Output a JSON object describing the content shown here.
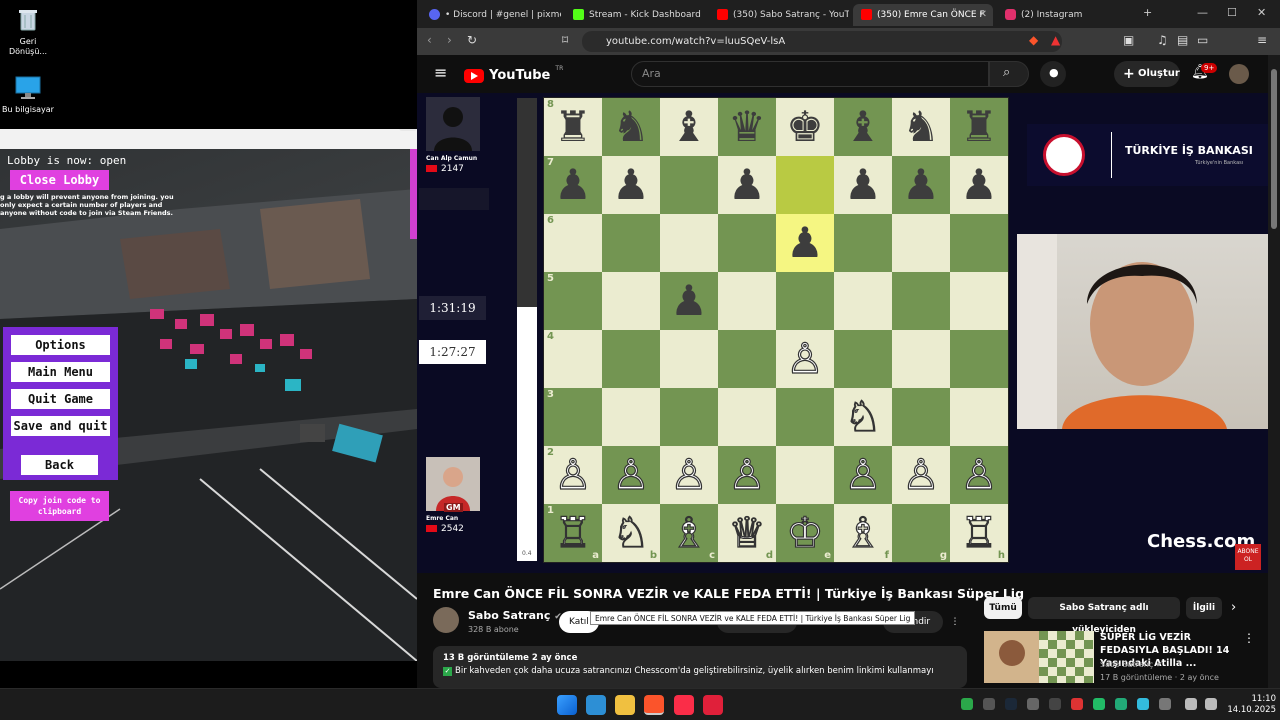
{
  "desktop": {
    "icons": [
      {
        "label": "Geri Dönüşü...",
        "icon": "recycle-bin-icon"
      },
      {
        "label": "Bu bilgisayar",
        "icon": "this-pc-icon"
      }
    ]
  },
  "game": {
    "lobby_status": "Lobby is now: open",
    "close_lobby": "Close Lobby",
    "lobby_note": "g a lobby will prevent anyone from joining. you only expect a certain number of players and anyone without code to join via Steam Friends.",
    "menu": {
      "options": "Options",
      "main_menu": "Main Menu",
      "quit_game": "Quit Game",
      "save_and_quit": "Save and quit",
      "back": "Back"
    },
    "copy_join_code": "Copy join code to clipboard",
    "accent_color": "#e040e0",
    "panel_color": "#7b2ad6"
  },
  "browser": {
    "tabs": [
      {
        "label": "• Discord | #genel | pixmens",
        "icon": "discord-icon",
        "color": "#5865f2"
      },
      {
        "label": "Stream - Kick Dashboard",
        "icon": "kick-icon",
        "color": "#53fc18"
      },
      {
        "label": "(350) Sabo Satranç - YouTube",
        "icon": "youtube-icon",
        "color": "#ff0000"
      },
      {
        "label": "(350) Emre Can ÖNCE F",
        "icon": "youtube-icon",
        "color": "#ff0000"
      },
      {
        "label": "(2) Instagram",
        "icon": "instagram-icon",
        "color": "#e1306c"
      }
    ],
    "url": "youtube.com/watch?v=luuSQeV-lsA"
  },
  "youtube": {
    "logo": "YouTube",
    "logo_region": "TR",
    "search_placeholder": "Ara",
    "create_label": "Oluştur",
    "notification_count": "9+",
    "video": {
      "top_player": {
        "name": "Can Alp Camun",
        "rating": "2147"
      },
      "bottom_player": {
        "name": "Emre Can",
        "title": "GM",
        "rating": "2542"
      },
      "top_clock": "1:31:19",
      "bottom_clock": "1:27:27",
      "eval": "0.4",
      "sponsor": "TÜRKİYE İŞ BANKASI",
      "sponsor_sub": "Türkiye'nin Bankası",
      "brand": "Chess.com",
      "abone_label": "ABONE OL",
      "board": [
        [
          "♜",
          "♞",
          "♝",
          "♛",
          "♚",
          "♝",
          "♞",
          "♜"
        ],
        [
          "♟",
          "♟",
          "",
          "♟",
          "",
          "♟",
          "♟",
          "♟"
        ],
        [
          "",
          "",
          "",
          "",
          "♟",
          "",
          "",
          ""
        ],
        [
          "",
          "",
          "♟",
          "",
          "",
          "",
          "",
          ""
        ],
        [
          "",
          "",
          "",
          "",
          "♙",
          "",
          "",
          ""
        ],
        [
          "",
          "",
          "",
          "",
          "",
          "♘",
          "",
          ""
        ],
        [
          "♙",
          "♙",
          "♙",
          "♙",
          "",
          "♙",
          "♙",
          "♙"
        ],
        [
          "♖",
          "♘",
          "♗",
          "♕",
          "♔",
          "♗",
          "",
          "♖"
        ]
      ],
      "ranks": [
        "8",
        "7",
        "6",
        "5",
        "4",
        "3",
        "2",
        "1"
      ],
      "files": [
        "a",
        "b",
        "c",
        "d",
        "e",
        "f",
        "g",
        "h"
      ]
    },
    "title": "Emre Can ÖNCE FİL SONRA VEZİR ve KALE FEDA ETTİ! | Türkiye İş Bankası Süper Lig",
    "tooltip": "Emre Can ÖNCE FİL SONRA VEZİR ve KALE FEDA ETTİ! | Türkiye İş Bankası Süper Lig",
    "channel": {
      "name": "Sabo Satranç",
      "subs": "328 B abone"
    },
    "join_label": "Katıl",
    "download_label": "İndir",
    "views": "13 B görüntüleme  2 ay önce",
    "description": "Bir kahveden çok daha ucuza satrancınızı Chesscom'da geliştirebilirsiniz, üyelik alırken benim linkimi kullanmayı",
    "chips": [
      "Tümü",
      "Sabo Satranç adlı yükleyiciden",
      "İlgili"
    ],
    "recommendation": {
      "title": "SÜPER LİG VEZİR FEDASIYLA BAŞLADI! 14 Yaşındaki Atilla ...",
      "channel": "Sabo Satranç",
      "meta": "17 B görüntüleme · 2 ay önce"
    }
  },
  "taskbar": {
    "time": "11:10",
    "date": "14.10.2025"
  }
}
